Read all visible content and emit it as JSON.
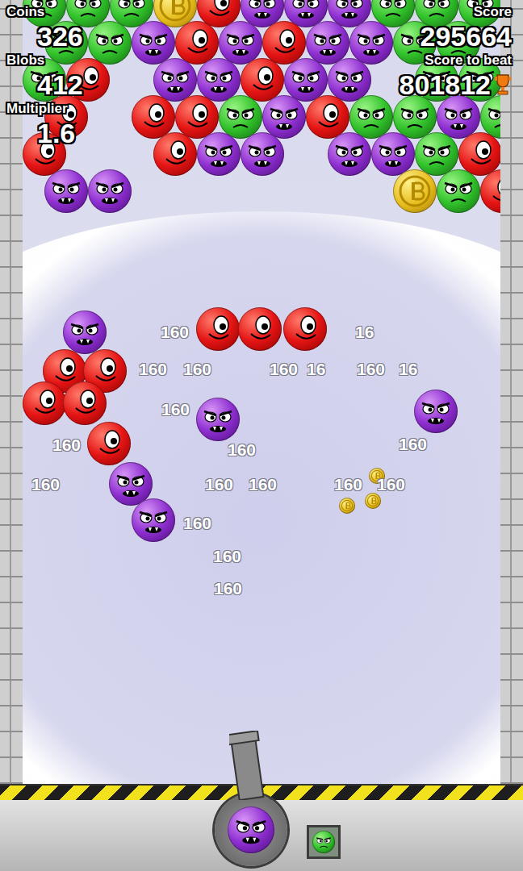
{
  "hud": {
    "coins": {
      "label": "Coins",
      "value": "326"
    },
    "blobs": {
      "label": "Blobs",
      "value": "412"
    },
    "multiplier": {
      "label": "Multiplier",
      "value": "1.6"
    },
    "score": {
      "label": "Score",
      "value": "295664"
    },
    "score_to_beat": {
      "label": "Score to beat",
      "value": "801812"
    }
  },
  "board": {
    "rows": [
      [
        "green",
        "green",
        "green",
        "coin",
        "red",
        "purple",
        "purple",
        "purple",
        "green",
        "green",
        "green"
      ],
      [
        "green",
        "green",
        "purple",
        "red",
        "purple",
        "red",
        "purple",
        "purple",
        "green",
        "green",
        "empty"
      ],
      [
        "green",
        "red",
        "empty",
        "purple",
        "purple",
        "red",
        "purple",
        "purple",
        "empty",
        "green",
        "green"
      ],
      [
        "red",
        "empty",
        "red",
        "red",
        "green",
        "purple",
        "red",
        "green",
        "green",
        "purple",
        "green"
      ],
      [
        "red",
        "empty",
        "empty",
        "red",
        "purple",
        "purple",
        "empty",
        "purple",
        "purple",
        "green",
        "red"
      ],
      [
        "purple",
        "purple",
        "empty",
        "empty",
        "empty",
        "empty",
        "empty",
        "empty",
        "coin",
        "green",
        "red"
      ]
    ]
  },
  "falling_blobs": [
    {
      "kind": "red"
    },
    {
      "kind": "red"
    },
    {
      "kind": "red"
    },
    {
      "kind": "purple"
    },
    {
      "kind": "red"
    },
    {
      "kind": "red"
    },
    {
      "kind": "red"
    },
    {
      "kind": "red"
    },
    {
      "kind": "red"
    },
    {
      "kind": "purple"
    },
    {
      "kind": "purple"
    },
    {
      "kind": "purple"
    },
    {
      "kind": "purple"
    },
    {
      "kind": "coin"
    },
    {
      "kind": "coin"
    },
    {
      "kind": "coin"
    }
  ],
  "score_popups": [
    "160",
    "160",
    "160",
    "160",
    "16",
    "160",
    "16",
    "16",
    "160",
    "160",
    "160",
    "160",
    "160",
    "160",
    "160",
    "160",
    "160",
    "160",
    "160",
    "160"
  ],
  "cannon": {
    "loaded": "purple"
  },
  "next_blob": {
    "kind": "green"
  }
}
